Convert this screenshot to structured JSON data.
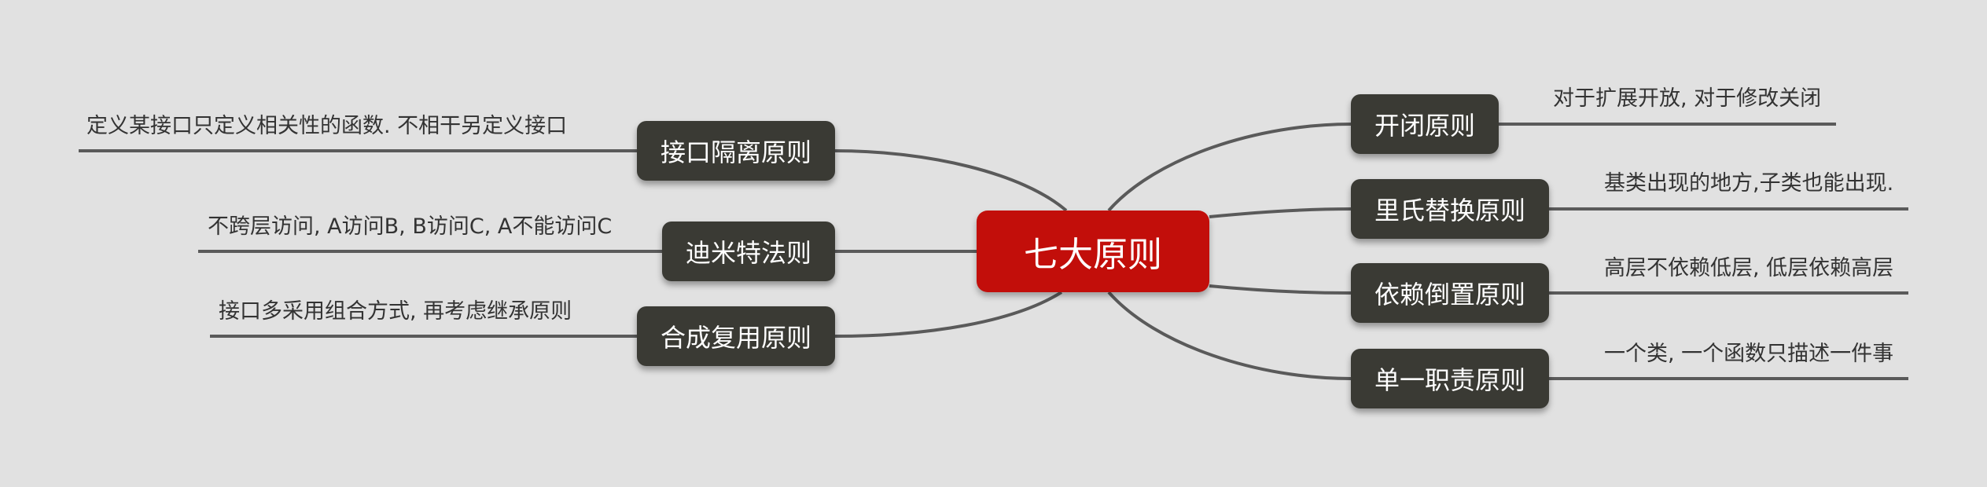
{
  "root": {
    "label": "七大原则"
  },
  "colors": {
    "background": "#e1e1e1",
    "root_fill": "#c20e0a",
    "node_fill": "#3a3a34",
    "line": "#5a5a5a",
    "text_dark": "#333333"
  },
  "right_branches": [
    {
      "label": "开闭原则",
      "description": "对于扩展开放, 对于修改关闭"
    },
    {
      "label": "里氏替换原则",
      "description": "基类出现的地方,子类也能出现."
    },
    {
      "label": "依赖倒置原则",
      "description": "高层不依赖低层, 低层依赖高层"
    },
    {
      "label": "单一职责原则",
      "description": "一个类, 一个函数只描述一件事"
    }
  ],
  "left_branches": [
    {
      "label": "接口隔离原则",
      "description": "定义某接口只定义相关性的函数. 不相干另定义接口"
    },
    {
      "label": "迪米特法则",
      "description": "不跨层访问, A访问B, B访问C, A不能访问C"
    },
    {
      "label": "合成复用原则",
      "description": "接口多采用组合方式, 再考虑继承原则"
    }
  ]
}
